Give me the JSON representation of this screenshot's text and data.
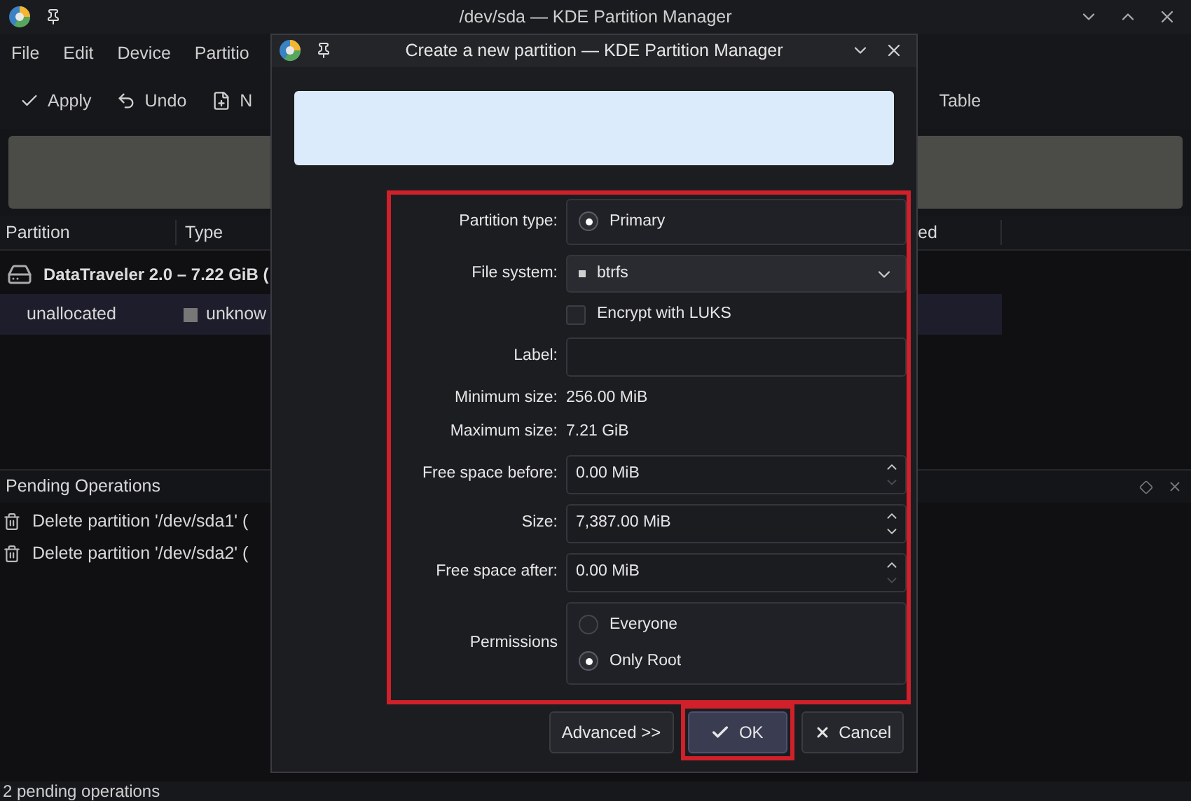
{
  "window": {
    "title": "/dev/sda — KDE Partition Manager"
  },
  "menu": [
    "File",
    "Edit",
    "Device",
    "Partitio"
  ],
  "toolbar": [
    {
      "label": "Apply"
    },
    {
      "label": "Undo"
    },
    {
      "label": "N"
    }
  ],
  "toolbar_right": "Table",
  "table": {
    "columns": [
      "Partition",
      "Type"
    ],
    "column_right": "ed",
    "rows": [
      {
        "kind": "device",
        "partition": "DataTraveler 2.0 – 7.22 GiB (",
        "selected": false
      },
      {
        "kind": "partition",
        "partition": "unallocated",
        "type": "unknow",
        "selected": true
      }
    ]
  },
  "pending": {
    "title": "Pending Operations",
    "items": [
      "Delete partition '/dev/sda1' (",
      "Delete partition '/dev/sda2' ("
    ]
  },
  "status_bar": "2 pending operations",
  "dialog": {
    "title": "Create a new partition — KDE Partition Manager",
    "form_highlighted": true,
    "fields": [
      {
        "kind": "radio_box",
        "label": "Partition type:",
        "options": [
          {
            "label": "Primary",
            "selected": true
          }
        ]
      },
      {
        "kind": "combo",
        "label": "File system:",
        "value": "btrfs"
      },
      {
        "kind": "checkbox",
        "label": "Encrypt with LUKS",
        "checked": false
      },
      {
        "kind": "text",
        "label": "Label:"
      },
      {
        "kind": "info",
        "label": "Minimum size:",
        "value": "256.00 MiB"
      },
      {
        "kind": "info",
        "label": "Maximum size:",
        "value": "7.21 GiB"
      },
      {
        "kind": "spin",
        "label": "Free space before:",
        "value": "0.00 MiB",
        "can_decrease": false
      },
      {
        "kind": "spin",
        "label": "Size:",
        "value": "7,387.00 MiB",
        "can_decrease": true
      },
      {
        "kind": "spin",
        "label": "Free space after:",
        "value": "0.00 MiB",
        "can_decrease": false
      },
      {
        "kind": "radio_box",
        "label": "Permissions",
        "options": [
          {
            "label": "Everyone",
            "selected": false
          },
          {
            "label": "Only Root",
            "selected": true
          }
        ]
      }
    ],
    "buttons": [
      {
        "kind": "advanced",
        "label": "Advanced >>",
        "highlighted": false
      },
      {
        "kind": "ok",
        "label": "OK",
        "highlighted": true
      },
      {
        "kind": "cancel",
        "label": "Cancel",
        "highlighted": false
      }
    ]
  }
}
